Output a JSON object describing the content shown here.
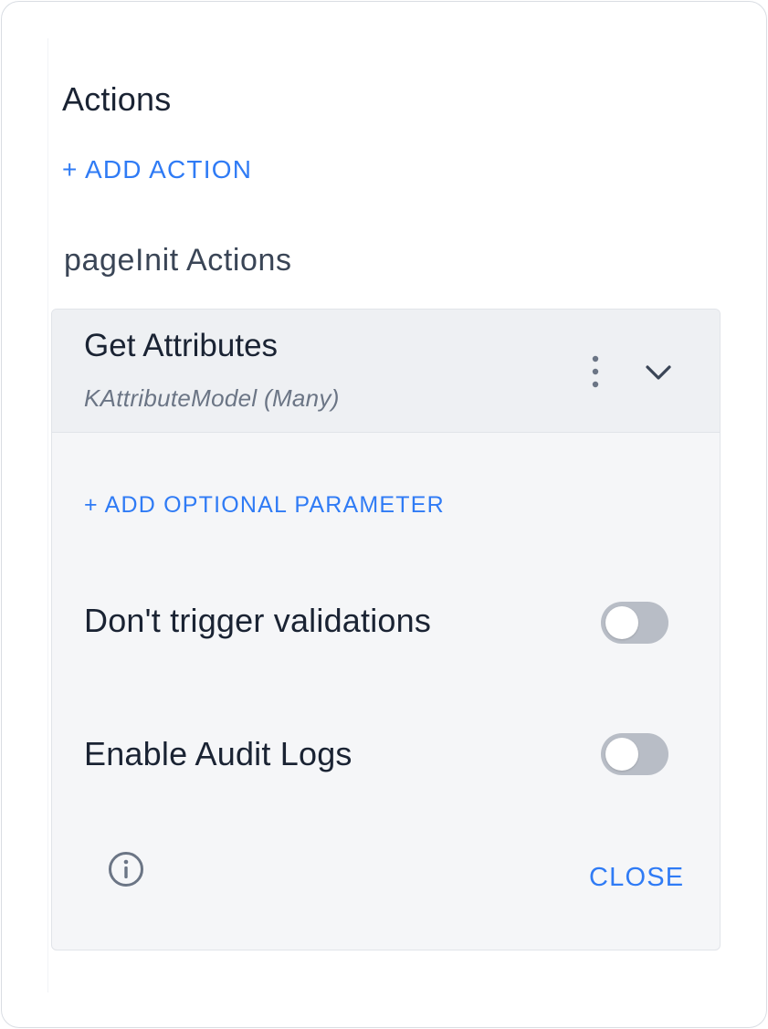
{
  "panel": {
    "title": "Actions",
    "add_action_label": "+ ADD ACTION",
    "group_title": "pageInit Actions"
  },
  "action_card": {
    "title": "Get Attributes",
    "subtitle": "KAttributeModel (Many)",
    "menu_icon": "kebab-menu-icon",
    "expand_icon": "chevron-down-icon",
    "add_param_label": "+ ADD OPTIONAL PARAMETER",
    "settings": [
      {
        "label": "Don't trigger validations",
        "enabled": false
      },
      {
        "label": "Enable Audit Logs",
        "enabled": false
      }
    ],
    "info_icon": "info-icon",
    "close_label": "CLOSE"
  },
  "colors": {
    "accent": "#2f7bf5",
    "text": "#1a2333",
    "muted": "#6b7585",
    "card_bg": "#f5f6f8",
    "header_bg": "#eef0f3",
    "toggle_off": "#b8bdc6"
  }
}
